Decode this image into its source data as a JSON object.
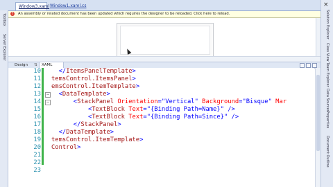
{
  "tabs": [
    {
      "label": "Window3.xaml"
    },
    {
      "label": "Window1.xaml.cs"
    }
  ],
  "toolbox_left": {
    "items": [
      "Toolbox",
      "Server Explorer"
    ]
  },
  "info_bar": {
    "text": "An assembly or related document has been updated which requires the designer to be reloaded. Click here to reload."
  },
  "split_tabs": {
    "design": "Design",
    "swap": "⇅",
    "xaml": "XAML"
  },
  "editor": {
    "lines": [
      {
        "num": "10",
        "indent": "  ",
        "parts": [
          [
            "br",
            "</"
          ],
          [
            "el",
            "ItemsPanelTemplate"
          ],
          [
            "br",
            ">"
          ]
        ]
      },
      {
        "num": "11",
        "indent": "",
        "parts": [
          [
            "el",
            "temsControl.ItemsPanel"
          ],
          [
            "br",
            ">"
          ]
        ]
      },
      {
        "num": "12",
        "indent": "",
        "parts": [
          [
            "el",
            "emsControl.ItemTemplate"
          ],
          [
            "br",
            ">"
          ]
        ]
      },
      {
        "num": "13",
        "indent": "  ",
        "parts": [
          [
            "br",
            "<"
          ],
          [
            "el",
            "DataTemplate"
          ],
          [
            "br",
            ">"
          ]
        ]
      },
      {
        "num": "14",
        "indent": "      ",
        "parts": [
          [
            "br",
            "<"
          ],
          [
            "el",
            "StackPanel"
          ],
          [
            "sp",
            " "
          ],
          [
            "at",
            "Orientation"
          ],
          [
            "br",
            "="
          ],
          [
            "va",
            "\"Vertical\""
          ],
          [
            "sp",
            " "
          ],
          [
            "at",
            "Background"
          ],
          [
            "br",
            "="
          ],
          [
            "va",
            "\"Bisque\""
          ],
          [
            "sp",
            " "
          ],
          [
            "at",
            "Mar"
          ]
        ]
      },
      {
        "num": "15",
        "indent": "          ",
        "parts": [
          [
            "br",
            "<"
          ],
          [
            "el",
            "TextBlock"
          ],
          [
            "sp",
            " "
          ],
          [
            "at",
            "Text"
          ],
          [
            "br",
            "="
          ],
          [
            "va",
            "\"{Binding Path=Name}\""
          ],
          [
            "sp",
            " "
          ],
          [
            "br",
            "/>"
          ]
        ]
      },
      {
        "num": "16",
        "indent": "          ",
        "parts": [
          [
            "br",
            "<"
          ],
          [
            "el",
            "TextBlock"
          ],
          [
            "sp",
            " "
          ],
          [
            "at",
            "Text"
          ],
          [
            "br",
            "="
          ],
          [
            "va",
            "\"{Binding Path=Since}\""
          ],
          [
            "sp",
            " "
          ],
          [
            "br",
            "/>"
          ]
        ]
      },
      {
        "num": "17",
        "indent": "      ",
        "parts": [
          [
            "br",
            "</"
          ],
          [
            "el",
            "StackPanel"
          ],
          [
            "br",
            ">"
          ]
        ]
      },
      {
        "num": "18",
        "indent": "  ",
        "parts": [
          [
            "br",
            "</"
          ],
          [
            "el",
            "DataTemplate"
          ],
          [
            "br",
            ">"
          ]
        ]
      },
      {
        "num": "19",
        "indent": "",
        "parts": [
          [
            "el",
            "temsControl.ItemTemplate"
          ],
          [
            "br",
            ">"
          ]
        ]
      },
      {
        "num": "20",
        "indent": "",
        "parts": [
          [
            "el",
            "Control"
          ],
          [
            "br",
            ">"
          ]
        ]
      },
      {
        "num": "21",
        "indent": "",
        "parts": []
      },
      {
        "num": "22",
        "indent": "",
        "parts": []
      },
      {
        "num": "23",
        "indent": "",
        "parts": []
      }
    ]
  },
  "tool_windows_right": {
    "items": [
      "Solution Explorer",
      "Class View",
      "Team Explorer",
      "Data Sources",
      "Properties",
      "Document Outline"
    ]
  },
  "colors": {
    "xml_element": "#a31515",
    "xml_attribute": "#ff0000",
    "xml_value": "#0000ff",
    "xml_bracket": "#0000ff",
    "line_number": "#2b91af",
    "change_bar": "#3fb34a",
    "info_bar_bg": "#ffffe1"
  },
  "icons": {
    "info": "error-circle-icon",
    "close": "close-icon",
    "cursor": "mouse-pointer-icon"
  }
}
